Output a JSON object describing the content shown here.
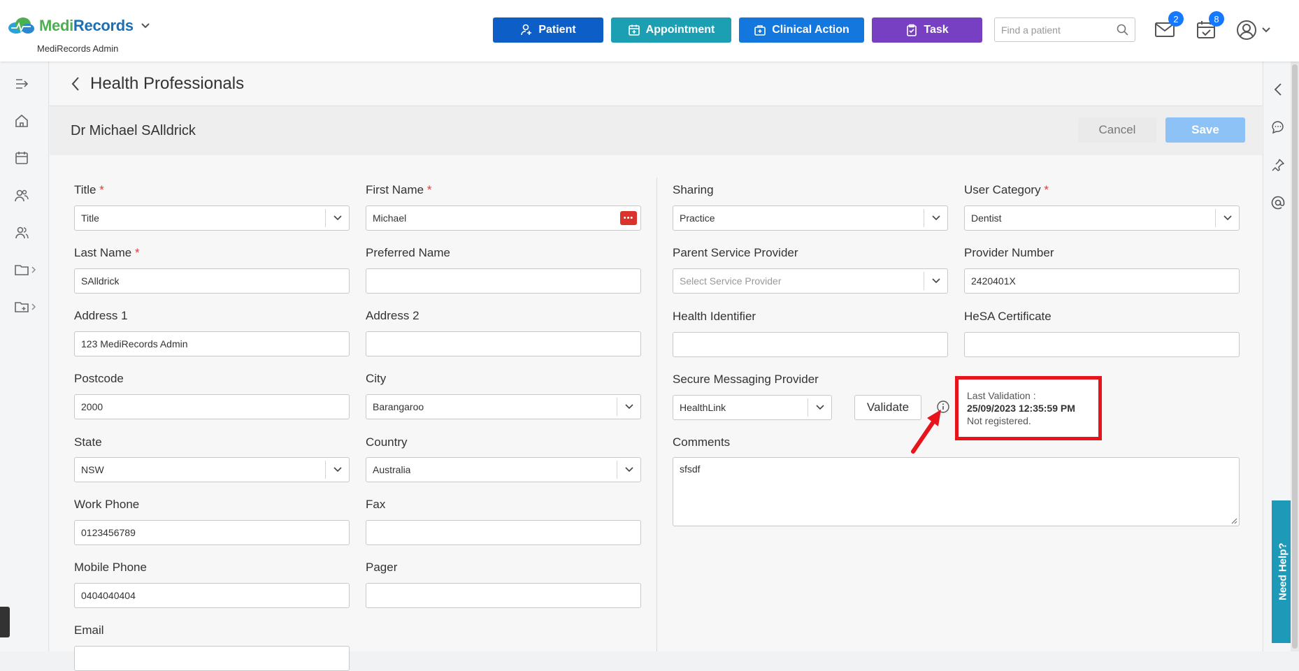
{
  "brand": {
    "name_part1": "Medi",
    "name_part2": "Records",
    "subtitle": "MediRecords Admin"
  },
  "header": {
    "buttons": {
      "patient": "Patient",
      "appointment": "Appointment",
      "clinical": "Clinical Action",
      "task": "Task"
    },
    "search_placeholder": "Find a patient",
    "messages_count": "2",
    "tasks_count": "8"
  },
  "page": {
    "breadcrumb_title": "Health Professionals",
    "record_name": "Dr Michael SAlldrick",
    "cancel_label": "Cancel",
    "save_label": "Save"
  },
  "form": {
    "title": {
      "label": "Title",
      "required": "*",
      "value": "Title"
    },
    "first_name": {
      "label": "First Name",
      "required": "*",
      "value": "Michael"
    },
    "last_name": {
      "label": "Last Name",
      "required": "*",
      "value": "SAlldrick"
    },
    "preferred_name": {
      "label": "Preferred Name",
      "value": ""
    },
    "address1": {
      "label": "Address 1",
      "value": "123 MediRecords Admin"
    },
    "address2": {
      "label": "Address 2",
      "value": ""
    },
    "postcode": {
      "label": "Postcode",
      "value": "2000"
    },
    "city": {
      "label": "City",
      "value": "Barangaroo"
    },
    "state": {
      "label": "State",
      "value": "NSW"
    },
    "country": {
      "label": "Country",
      "value": "Australia"
    },
    "work_phone": {
      "label": "Work Phone",
      "value": "0123456789"
    },
    "fax": {
      "label": "Fax",
      "value": ""
    },
    "mobile_phone": {
      "label": "Mobile Phone",
      "value": "0404040404"
    },
    "pager": {
      "label": "Pager",
      "value": ""
    },
    "email": {
      "label": "Email",
      "value": ""
    },
    "sharing": {
      "label": "Sharing",
      "value": "Practice"
    },
    "user_category": {
      "label": "User Category",
      "required": "*",
      "value": "Dentist"
    },
    "parent_provider": {
      "label": "Parent Service Provider",
      "placeholder": "Select Service Provider"
    },
    "provider_number": {
      "label": "Provider Number",
      "value": "2420401X"
    },
    "health_identifier": {
      "label": "Health Identifier",
      "value": ""
    },
    "hesa_certificate": {
      "label": "HeSA Certificate",
      "value": ""
    },
    "secure_messaging": {
      "label": "Secure Messaging Provider",
      "value": "HealthLink",
      "validate_label": "Validate"
    },
    "comments": {
      "label": "Comments",
      "value": "sfsdf"
    }
  },
  "validation_tooltip": {
    "heading": "Last Validation :",
    "datetime": "25/09/2023 12:35:59 PM",
    "status": "Not registered."
  },
  "help_tab": {
    "label": "Need Help?"
  },
  "colors": {
    "patient": "#0d5fc7",
    "appointment": "#1d9fb3",
    "clinical": "#1477dd",
    "task": "#7740c2",
    "save": "#8cc2f5",
    "highlight": "#e8141b",
    "required": "#e53935"
  }
}
